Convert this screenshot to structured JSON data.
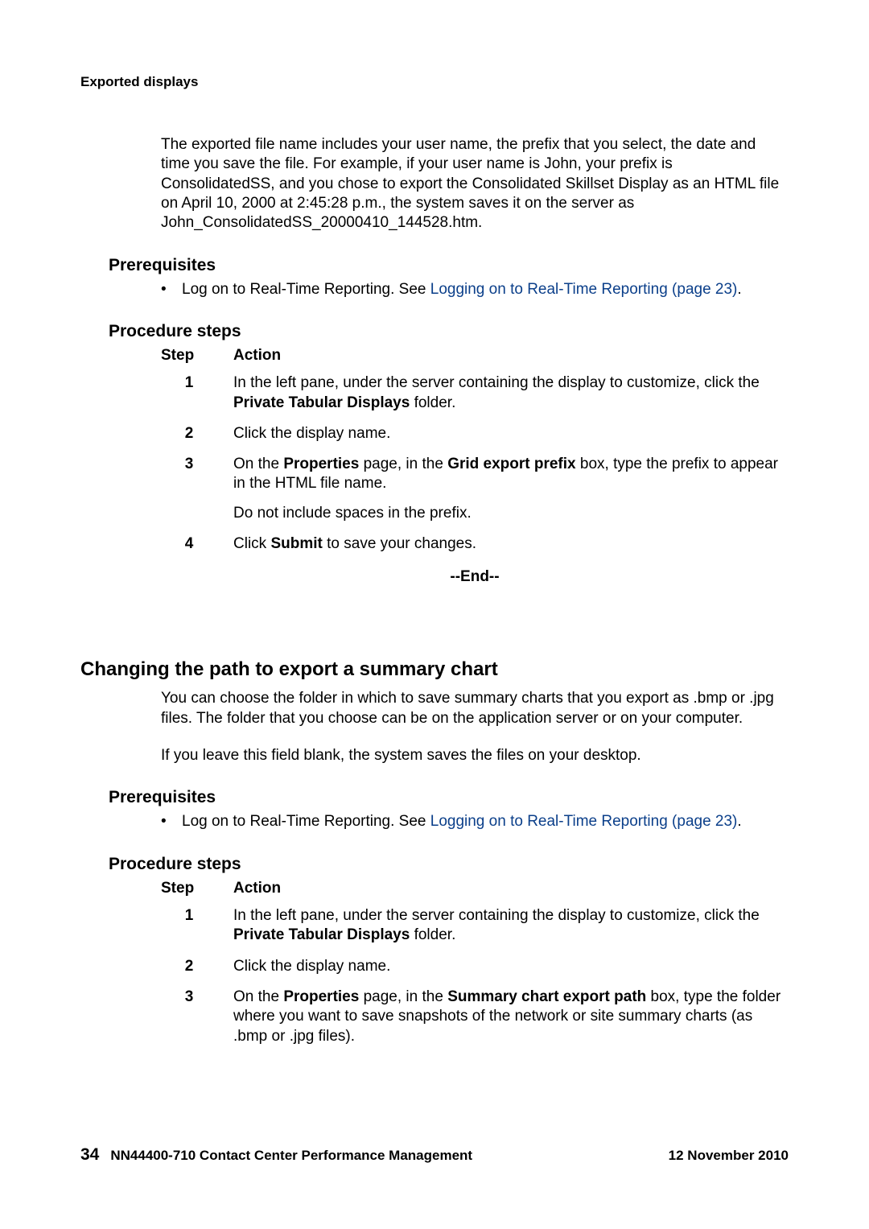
{
  "runningHeader": "Exported displays",
  "introPara": "The exported file name includes your user name, the prefix that you select, the date and time you save the file. For example, if your user name is John, your prefix is ConsolidatedSS, and you chose to export the Consolidated Skillset Display as an HTML file on April 10, 2000 at 2:45:28 p.m., the system saves it on the server as John_ConsolidatedSS_20000410_144528.htm.",
  "section1": {
    "prereqHeading": "Prerequisites",
    "prereqText": "Log on to Real-Time Reporting. See ",
    "prereqLink": "Logging on to Real-Time Reporting (page 23)",
    "prereqAfter": ".",
    "procHeading": "Procedure steps",
    "colStep": "Step",
    "colAction": "Action",
    "rows": [
      {
        "n": "1",
        "parts": [
          {
            "t": "plain",
            "v": "In the left pane, under the server containing the display to customize, click the "
          },
          {
            "t": "bold",
            "v": "Private Tabular Displays"
          },
          {
            "t": "plain",
            "v": " folder."
          }
        ]
      },
      {
        "n": "2",
        "parts": [
          {
            "t": "plain",
            "v": "Click the display name."
          }
        ]
      },
      {
        "n": "3",
        "parts": [
          {
            "t": "plain",
            "v": "On the "
          },
          {
            "t": "bold",
            "v": "Properties"
          },
          {
            "t": "plain",
            "v": " page, in the "
          },
          {
            "t": "bold",
            "v": "Grid export prefix"
          },
          {
            "t": "plain",
            "v": " box, type the prefix to appear in the HTML file name."
          }
        ],
        "extra": "Do not include spaces in the prefix."
      },
      {
        "n": "4",
        "parts": [
          {
            "t": "plain",
            "v": "Click "
          },
          {
            "t": "bold",
            "v": "Submit"
          },
          {
            "t": "plain",
            "v": " to save your changes."
          }
        ]
      }
    ],
    "end": "--End--"
  },
  "section2": {
    "heading": "Changing the path to export a summary chart",
    "para1": "You can choose the folder in which to save summary charts that you export as .bmp or .jpg files. The folder that you choose can be on the application server or on your computer.",
    "para2": "If you leave this field blank, the system saves the files on your desktop.",
    "prereqHeading": "Prerequisites",
    "prereqText": "Log on to Real-Time Reporting. See ",
    "prereqLink": "Logging on to Real-Time Reporting (page 23)",
    "prereqAfter": ".",
    "procHeading": "Procedure steps",
    "colStep": "Step",
    "colAction": "Action",
    "rows": [
      {
        "n": "1",
        "parts": [
          {
            "t": "plain",
            "v": "In the left pane, under the server containing the display to customize, click the "
          },
          {
            "t": "bold",
            "v": "Private Tabular Displays"
          },
          {
            "t": "plain",
            "v": " folder."
          }
        ]
      },
      {
        "n": "2",
        "parts": [
          {
            "t": "plain",
            "v": "Click the display name."
          }
        ]
      },
      {
        "n": "3",
        "parts": [
          {
            "t": "plain",
            "v": "On the "
          },
          {
            "t": "bold",
            "v": "Properties"
          },
          {
            "t": "plain",
            "v": " page, in the "
          },
          {
            "t": "bold",
            "v": "Summary chart export path"
          },
          {
            "t": "plain",
            "v": " box, type the folder where you want to save snapshots of the network or site summary charts (as .bmp or .jpg files)."
          }
        ]
      }
    ]
  },
  "footer": {
    "pageNum": "34",
    "docTitle": "NN44400-710 Contact Center Performance Management",
    "date": "12 November 2010"
  }
}
